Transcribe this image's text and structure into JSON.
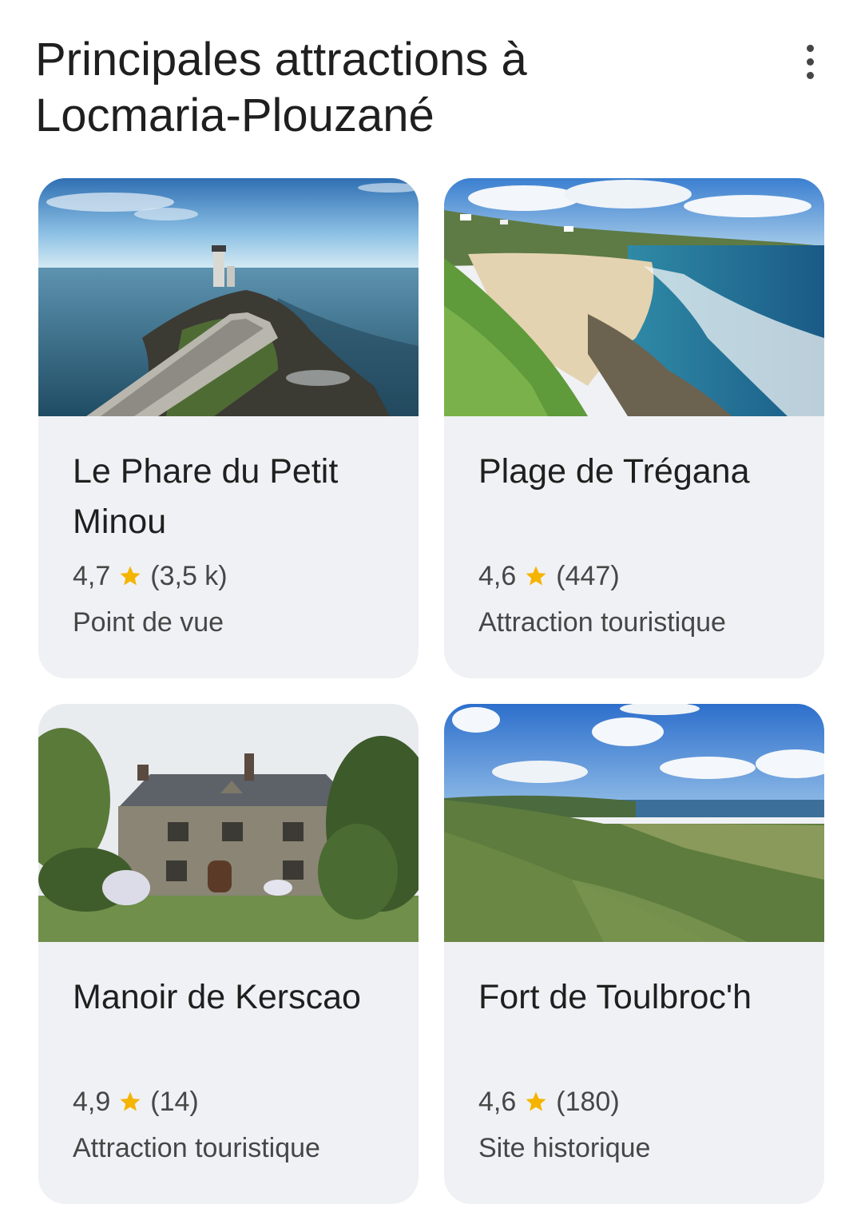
{
  "header": {
    "title_line1": "Principales attractions à",
    "title_line2": "Locmaria-Plouzané",
    "more_icon": "more-vert-icon"
  },
  "accent_star_color": "#f4b400",
  "cards": [
    {
      "name": "Le Phare du Petit Minou",
      "rating": "4,7",
      "reviews": "(3,5 k)",
      "category": "Point de vue",
      "image": "lighthouse-photo"
    },
    {
      "name": "Plage de Trégana",
      "rating": "4,6",
      "reviews": "(447)",
      "category": "Attraction touristique",
      "image": "beach-photo"
    },
    {
      "name": "Manoir de Kerscao",
      "rating": "4,9",
      "reviews": "(14)",
      "category": "Attraction touristique",
      "image": "manor-photo"
    },
    {
      "name": "Fort de Toulbroc'h",
      "rating": "4,6",
      "reviews": "(180)",
      "category": "Site historique",
      "image": "coast-photo"
    }
  ]
}
